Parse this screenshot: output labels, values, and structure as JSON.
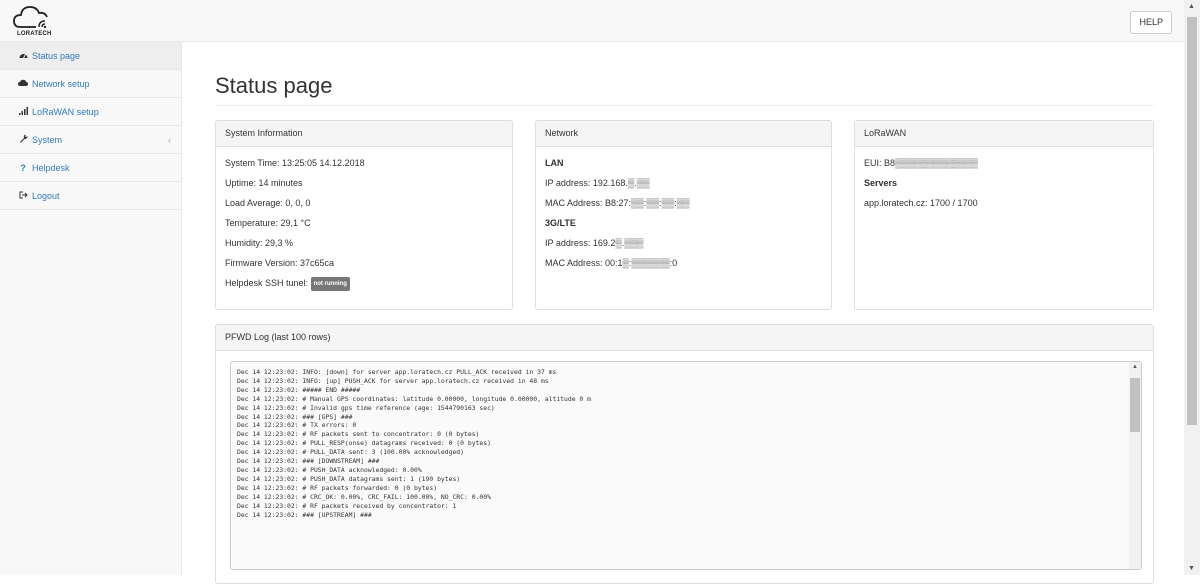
{
  "header": {
    "logo_text": "LORATECH",
    "help_label": "HELP"
  },
  "sidebar": {
    "items": [
      {
        "label": "Status page",
        "icon": "dashboard-icon"
      },
      {
        "label": "Network setup",
        "icon": "cloud-icon"
      },
      {
        "label": "LoRaWAN setup",
        "icon": "signal-icon"
      },
      {
        "label": "System",
        "icon": "wrench-icon"
      },
      {
        "label": "Helpdesk",
        "icon": "question-icon"
      },
      {
        "label": "Logout",
        "icon": "logout-icon"
      }
    ],
    "system_chevron": "‹"
  },
  "main": {
    "title": "Status page",
    "system_info": {
      "heading": "System Information",
      "system_time": "System Time: 13:25:05 14.12.2018",
      "uptime": "Uptime: 14 minutes",
      "load_average": "Load Average: 0, 0, 0",
      "temperature": "Temperature: 29,1 °C",
      "humidity": "Humidity: 29,3 %",
      "firmware": "Firmware Version: 37c65ca",
      "ssh_label": "Helpdesk SSH tunel:",
      "ssh_status": "not running"
    },
    "network": {
      "heading": "Network",
      "lan_label": "LAN",
      "lan_ip": "IP address: 192.168.▒.▒▒",
      "lan_mac": "MAC Address: B8:27:▒▒:▒▒:▒▒:▒▒",
      "lte_label": "3G/LTE",
      "lte_ip": "IP address: 169.2▒.▒▒▒",
      "lte_mac": "MAC Address: 00:1▒:▒▒▒▒▒▒:0"
    },
    "lorawan": {
      "heading": "LoRaWAN",
      "eui": "EUI: B8▒▒▒▒▒▒▒▒▒▒▒▒▒",
      "servers_label": "Servers",
      "server": "app.loratech.cz: 1700 / 1700"
    },
    "log": {
      "heading": "PFWD Log (last 100 rows)",
      "lines": [
        "Dec 14 12:23:02: INFO: [down] for server app.loratech.cz PULL_ACK received in 37 ms",
        "Dec 14 12:23:02: INFO: [up] PUSH_ACK for server app.loratech.cz received in 48 ms",
        "Dec 14 12:23:02: ##### END #####",
        "Dec 14 12:23:02: # Manual GPS coordinates: latitude 0.00000, longitude 0.00000, altitude 0 m",
        "Dec 14 12:23:02: # Invalid gps time reference (age: 1544790163 sec)",
        "Dec 14 12:23:02: ### [GPS] ###",
        "Dec 14 12:23:02: # TX errors: 0",
        "Dec 14 12:23:02: # RF packets sent to concentrator: 0 (0 bytes)",
        "Dec 14 12:23:02: # PULL_RESP(onse) datagrams received: 0 (0 bytes)",
        "Dec 14 12:23:02: # PULL_DATA sent: 3 (100.00% acknowledged)",
        "Dec 14 12:23:02: ### [DOWNSTREAM] ###",
        "Dec 14 12:23:02: # PUSH_DATA acknowledged: 0.00%",
        "Dec 14 12:23:02: # PUSH_DATA datagrams sent: 1 (190 bytes)",
        "Dec 14 12:23:02: # RF packets forwarded: 0 (0 bytes)",
        "Dec 14 12:23:02: # CRC_OK: 0.00%, CRC_FAIL: 100.00%, NO_CRC: 0.00%",
        "Dec 14 12:23:02: # RF packets received by concentrator: 1",
        "Dec 14 12:23:02: ### [UPSTREAM] ###"
      ]
    }
  }
}
